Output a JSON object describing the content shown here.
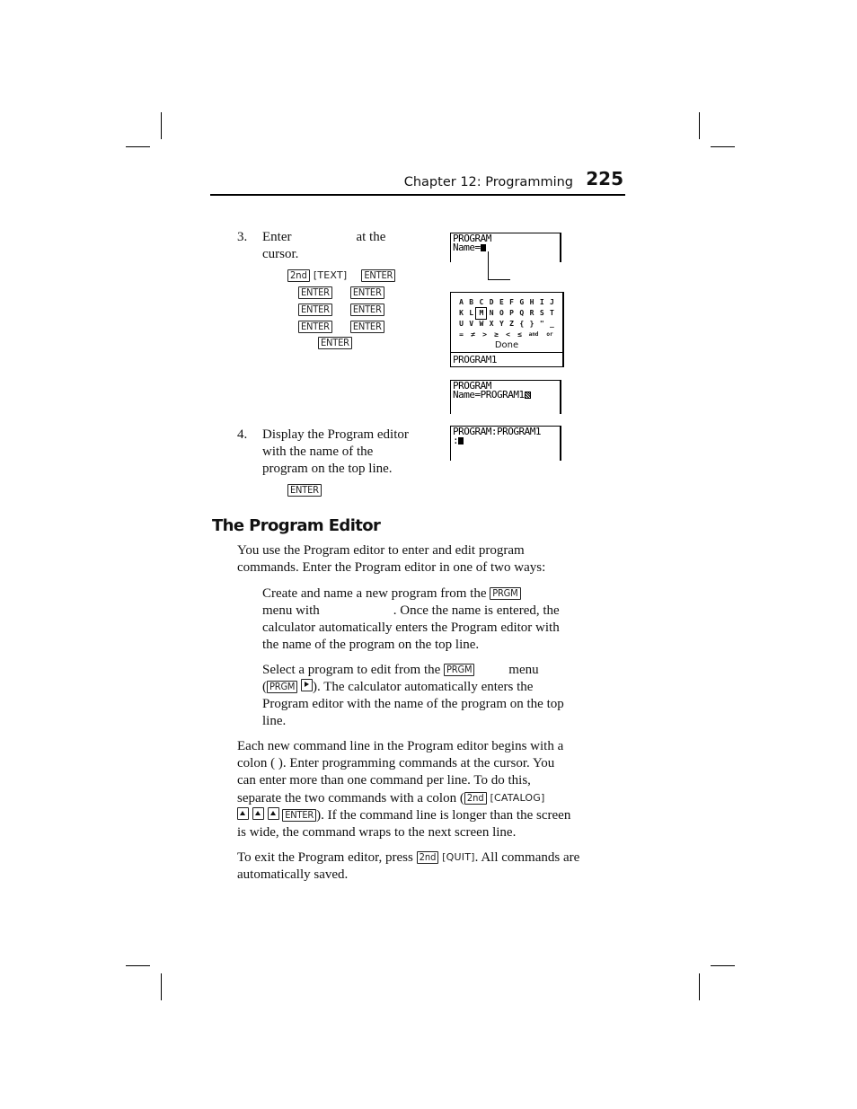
{
  "header": {
    "chapter": "Chapter 12: Programming",
    "page_number": "225"
  },
  "step3": {
    "number": "3.",
    "text_a": "Enter",
    "text_b": "at the",
    "text_c": "cursor.",
    "keys": {
      "second": "2nd",
      "text_fn": "[TEXT]",
      "enter": "ENTER"
    }
  },
  "screens": {
    "name_prompt": {
      "line1": "PROGRAM",
      "line2": "Name="
    },
    "char_menu": {
      "rows": [
        [
          "A",
          "B",
          "C",
          "D",
          "E",
          "F",
          "G",
          "H",
          "I",
          "J"
        ],
        [
          "K",
          "L",
          "M",
          "N",
          "O",
          "P",
          "Q",
          "R",
          "S",
          "T"
        ],
        [
          "U",
          "V",
          "W",
          "X",
          "Y",
          "Z",
          "{",
          "}",
          "\"",
          "_"
        ],
        [
          "=",
          "≠",
          ">",
          "≥",
          "<",
          "≤",
          "and",
          "or"
        ]
      ],
      "selected": "M",
      "done_label": "Done",
      "entry": "PROGRAM1"
    },
    "name_filled": {
      "line1": "PROGRAM",
      "line2": "Name=PROGRAM1"
    },
    "editor": {
      "line1": "PROGRAM:PROGRAM1",
      "line2": ":"
    }
  },
  "step4": {
    "number": "4.",
    "lines": [
      "Display the Program editor",
      "with the name of the",
      "program on the top line."
    ],
    "key": "ENTER"
  },
  "section": {
    "title": "The Program Editor",
    "intro": [
      "You use the Program editor to enter and edit program",
      "commands. Enter the Program editor in one of two ways:"
    ],
    "bullet1": {
      "l1": "Create and name a new program from the",
      "key": "PRGM",
      "l2a": "menu with",
      "l2b": ". Once the name is entered, the",
      "l3": "calculator automatically enters the Program editor with",
      "l4": "the name of the program on the top line."
    },
    "bullet2": {
      "l1a": "Select a program to edit from the",
      "key": "PRGM",
      "l1b": "menu",
      "l2a": "(",
      "l2b": "). The calculator automatically enters the",
      "l3": "Program editor with the name of the program on the top",
      "l4": "line."
    },
    "para_colon": {
      "l1": "Each new command line in the Program editor begins with a",
      "l2": "colon ( ). Enter programming commands at the cursor. You",
      "l3": "can enter more than one command per line. To do this,",
      "l4a": "separate the two commands with a colon (",
      "key_2nd": "2nd",
      "catalog": "[CATALOG]",
      "enter": "ENTER",
      "l5b": "). If the command line is longer than the screen",
      "l6": "is wide, the command wraps to the next screen line."
    },
    "para_exit": {
      "l1a": "To exit the Program editor, press",
      "key_2nd": "2nd",
      "quit": "[QUIT]",
      "l1b": ". All commands are",
      "l2": "automatically saved."
    }
  }
}
